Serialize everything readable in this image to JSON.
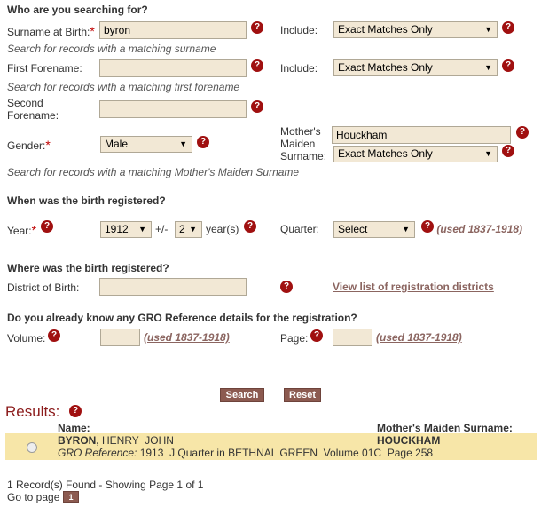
{
  "section_who": "Who are you searching for?",
  "surname": {
    "label": "Surname at Birth:",
    "value": "byron",
    "hint": "Search for records with a matching surname"
  },
  "include1": {
    "label": "Include:",
    "value": "Exact Matches Only"
  },
  "first_forename": {
    "label": "First Forename:",
    "value": "",
    "hint": "Search for records with a matching first forename"
  },
  "include2": {
    "label": "Include:",
    "value": "Exact Matches Only"
  },
  "second_forename": {
    "label_line1": "Second",
    "label_line2": "Forename:",
    "value": ""
  },
  "gender": {
    "label": "Gender:",
    "value": "Male"
  },
  "mmn": {
    "label_line1": "Mother's",
    "label_line2": "Maiden",
    "label_line3": "Surname:",
    "value": "Houckham",
    "include_value": "Exact Matches Only",
    "hint": "Search for records with a matching Mother's Maiden Surname"
  },
  "section_when": "When was the birth registered?",
  "year": {
    "label": "Year:",
    "value": "1912",
    "plusminus": "+/-",
    "range": "2",
    "unit": "year(s)"
  },
  "quarter": {
    "label": "Quarter:",
    "value": "Select",
    "note": " (used 1837-1918)"
  },
  "section_where": "Where was the birth registered?",
  "district": {
    "label": "District of Birth:",
    "value": "",
    "link": "View list of registration districts"
  },
  "section_gro": "Do you already know any GRO Reference details for the registration?",
  "volume": {
    "label": "Volume:",
    "value": "",
    "note": "(used 1837-1918)"
  },
  "page_ref": {
    "label": "Page:",
    "value": "",
    "note": "(used 1837-1918)"
  },
  "buttons": {
    "search": "Search",
    "reset": "Reset"
  },
  "results": {
    "title": "Results:",
    "col_name": "Name:",
    "col_mmn": "Mother's Maiden Surname:",
    "row": {
      "surname": "BYRON,",
      "forenames": " HENRY  JOHN",
      "mmn": "HOUCKHAM",
      "gro_label": "GRO Reference:",
      "gro_value": " 1913  J Quarter in BETHNAL GREEN  Volume 01C  Page 258"
    },
    "summary": "1 Record(s) Found - Showing Page 1 of 1",
    "goto": "Go to page",
    "page": "1"
  },
  "icons": {
    "help": "?",
    "dropdown": "▼",
    "required": "*"
  },
  "colors": {
    "input_bg": "#f2e8d5",
    "help_icon": "#a01010",
    "button": "#8c5a50",
    "results_row": "#f7e6a8",
    "link": "#8b6560",
    "results_title": "#8c1c1c"
  }
}
